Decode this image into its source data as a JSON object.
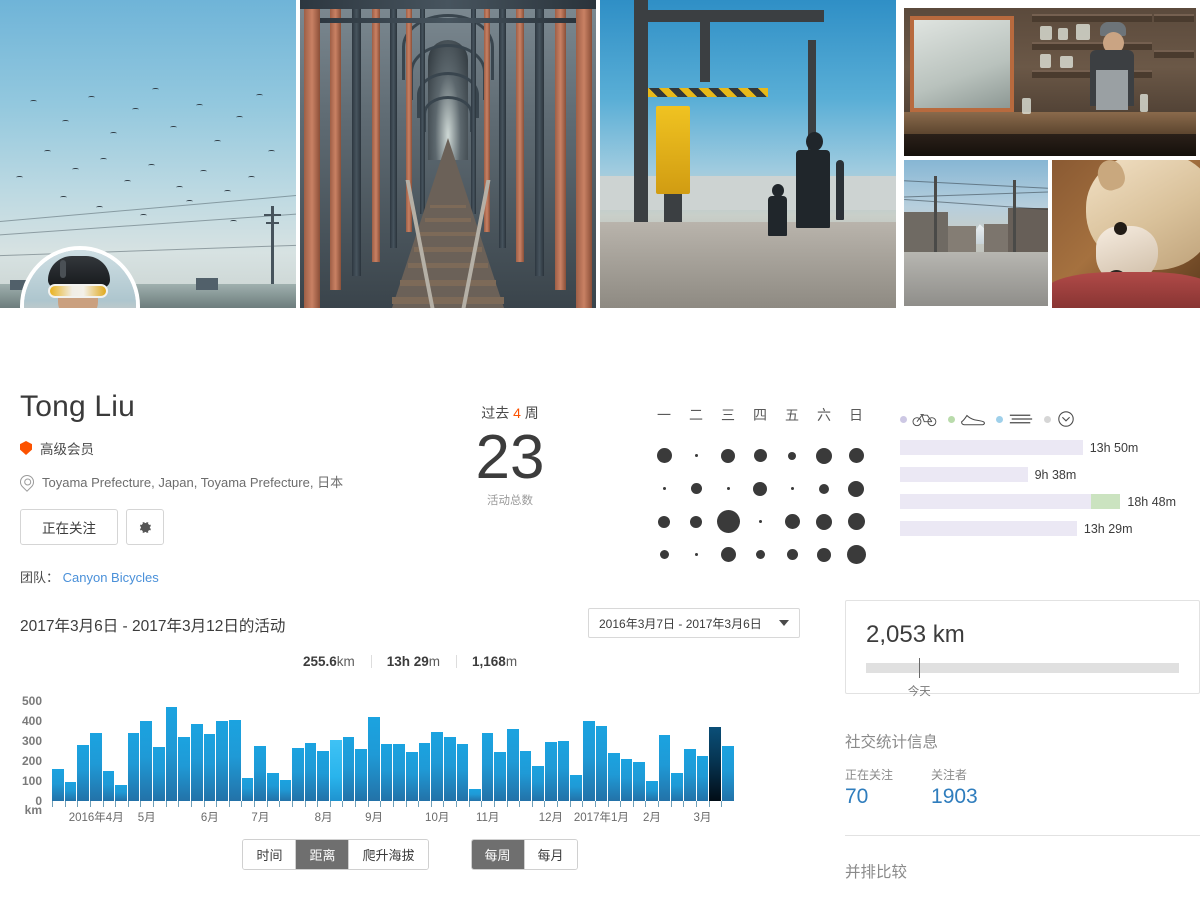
{
  "banner": {
    "photos": [
      {
        "name": "birds-sky-photo",
        "alt": "birds flying over sky with power lines"
      },
      {
        "name": "railway-bridge-photo",
        "alt": "rusty steel railway bridge tracks"
      },
      {
        "name": "level-crossing-photo",
        "alt": "man and child at railway level crossing"
      },
      {
        "name": "shop-interior-photo",
        "alt": "cook at counter in small shop"
      },
      {
        "name": "street-photo",
        "alt": "quiet japanese street with mountains"
      },
      {
        "name": "dog-photo",
        "alt": "shiba dog resting on red blanket"
      }
    ]
  },
  "profile": {
    "name": "Tong Liu",
    "membership": "高级会员",
    "location": "Toyama Prefecture, Japan, Toyama Prefecture, 日本",
    "follow_button": "正在关注",
    "settings_icon": "gear-icon",
    "team_label": "团队：",
    "team_name": "Canyon Bicycles"
  },
  "summary": {
    "period_prefix": "过去 ",
    "period_num": "4",
    "period_suffix": " 周",
    "count": "23",
    "count_label": "活动总数"
  },
  "dotgrid": {
    "weekdays": [
      "一",
      "二",
      "三",
      "四",
      "五",
      "六",
      "日"
    ],
    "rows": [
      [
        15,
        3,
        14,
        13,
        8,
        16,
        15
      ],
      [
        3,
        11,
        3,
        14,
        3,
        10,
        16
      ],
      [
        12,
        12,
        23,
        3,
        15,
        16,
        17
      ],
      [
        9,
        3,
        15,
        9,
        11,
        14,
        19
      ]
    ]
  },
  "legend": [
    {
      "icon": "bicycle-icon",
      "color": "#cdc8e4"
    },
    {
      "icon": "running-shoe-icon",
      "color": "#b9dbab"
    },
    {
      "icon": "swim-waves-icon",
      "color": "#9fd0ea"
    },
    {
      "icon": "clock-icon",
      "color": "#d6d6d6"
    }
  ],
  "week_bars": [
    {
      "value": "13h 50m",
      "base_pct": 63,
      "accent_pct": 0
    },
    {
      "value": "9h 38m",
      "base_pct": 44,
      "accent_pct": 0
    },
    {
      "value": "18h 48m",
      "base_pct": 76,
      "accent_pct": 10
    },
    {
      "value": "13h 29m",
      "base_pct": 61,
      "accent_pct": 0
    }
  ],
  "chart_panel": {
    "title": "2017年3月6日 - 2017年3月12日的活动",
    "range_select": "2016年3月7日 - 2017年3月6日",
    "totals": [
      {
        "value": "255.6",
        "unit": "km"
      },
      {
        "value": "13h 29",
        "unit": "m"
      },
      {
        "value": "1,168",
        "unit": "m"
      }
    ],
    "metric_toggle": [
      {
        "label": "时间",
        "active": false
      },
      {
        "label": "距离",
        "active": true
      },
      {
        "label": "爬升海拔",
        "active": false
      }
    ],
    "period_toggle": [
      {
        "label": "每周",
        "active": true
      },
      {
        "label": "每月",
        "active": false
      }
    ]
  },
  "chart_data": {
    "type": "bar",
    "title": "2017年3月6日 - 2017年3月12日的活动",
    "xlabel": "",
    "ylabel": "km",
    "ylim": [
      0,
      500
    ],
    "yticks": [
      0,
      100,
      200,
      300,
      400,
      500
    ],
    "ytick_labels": [
      "0",
      "100",
      "200",
      "300",
      "400",
      "500"
    ],
    "grid": false,
    "legend_position": "none",
    "selected_index": 52,
    "highlight_index": 22,
    "x_tick_labels": [
      {
        "label": "2016年4月",
        "index": 3
      },
      {
        "label": "5月",
        "index": 7
      },
      {
        "label": "6月",
        "index": 12
      },
      {
        "label": "7月",
        "index": 16
      },
      {
        "label": "8月",
        "index": 21
      },
      {
        "label": "9月",
        "index": 25
      },
      {
        "label": "10月",
        "index": 30
      },
      {
        "label": "11月",
        "index": 34
      },
      {
        "label": "12月",
        "index": 39
      },
      {
        "label": "2017年1月",
        "index": 43
      },
      {
        "label": "2月",
        "index": 47
      },
      {
        "label": "3月",
        "index": 51
      }
    ],
    "values": [
      160,
      95,
      280,
      338,
      150,
      80,
      338,
      398,
      268,
      470,
      320,
      385,
      333,
      398,
      403,
      115,
      273,
      142,
      103,
      263,
      290,
      250,
      305,
      322,
      258,
      418,
      285,
      283,
      243,
      288,
      345,
      318,
      283,
      60,
      340,
      245,
      360,
      250,
      175,
      295,
      300,
      130,
      400,
      375,
      238,
      208,
      193,
      100,
      330,
      140,
      262,
      225,
      370,
      275
    ]
  },
  "sidebar": {
    "ytd_distance": "2,053 km",
    "today_label": "今天",
    "today_pct": 17,
    "social_heading": "社交统计信息",
    "following_label": "正在关注",
    "following_value": "70",
    "followers_label": "关注者",
    "followers_value": "1903",
    "compare_heading": "并排比较"
  }
}
